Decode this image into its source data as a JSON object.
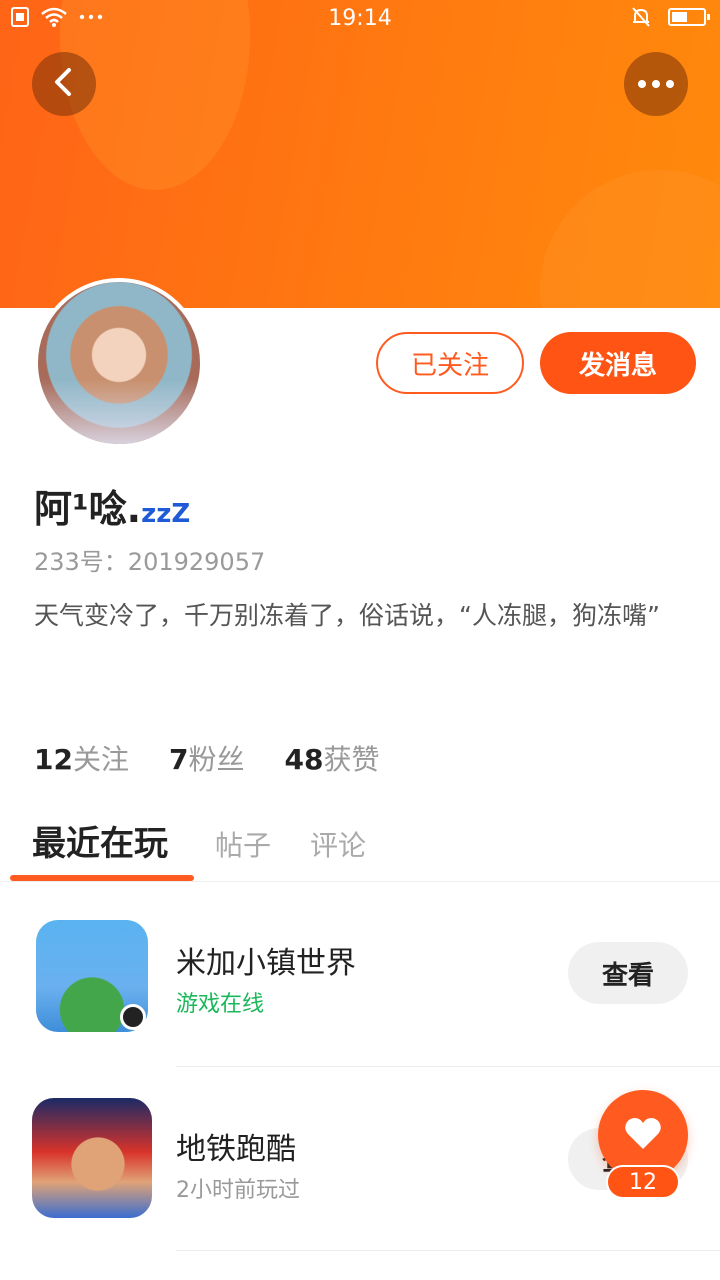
{
  "status_bar": {
    "time": "19:14"
  },
  "profile": {
    "nickname_main": "阿¹唸.",
    "nickname_suffix": "zzZ",
    "uid_text": "233号：201929057",
    "bio": "天气变冷了，千万别冻着了，俗话说，“人冻腿，狗冻嘴”",
    "followed_label": "已关注",
    "message_label": "发消息"
  },
  "stats": [
    {
      "num": "12",
      "label": "关注"
    },
    {
      "num": "7",
      "label": "粉丝"
    },
    {
      "num": "48",
      "label": "获赞"
    }
  ],
  "tabs": [
    {
      "label": "最近在玩",
      "active": true
    },
    {
      "label": "帖子",
      "active": false
    },
    {
      "label": "评论",
      "active": false
    }
  ],
  "games": [
    {
      "name": "米加小镇世界",
      "status": "游戏在线",
      "status_color": "#1bb85b",
      "button": "查看"
    },
    {
      "name": "地铁跑酷",
      "status": "2小时前玩过",
      "status_color": "#999999",
      "button": "查看"
    }
  ],
  "like_fab": {
    "count": "12"
  },
  "colors": {
    "accent": "#ff5413",
    "banner": "#ff7a10"
  }
}
